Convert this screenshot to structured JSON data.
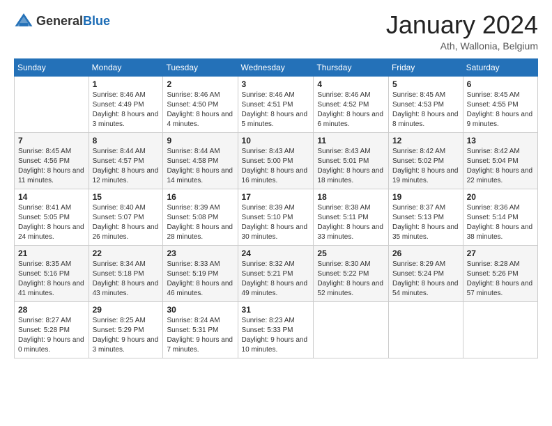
{
  "header": {
    "logo_general": "General",
    "logo_blue": "Blue",
    "month_title": "January 2024",
    "subtitle": "Ath, Wallonia, Belgium"
  },
  "weekdays": [
    "Sunday",
    "Monday",
    "Tuesday",
    "Wednesday",
    "Thursday",
    "Friday",
    "Saturday"
  ],
  "rows": [
    [
      {
        "day": "",
        "sunrise": "",
        "sunset": "",
        "daylight": ""
      },
      {
        "day": "1",
        "sunrise": "Sunrise: 8:46 AM",
        "sunset": "Sunset: 4:49 PM",
        "daylight": "Daylight: 8 hours and 3 minutes."
      },
      {
        "day": "2",
        "sunrise": "Sunrise: 8:46 AM",
        "sunset": "Sunset: 4:50 PM",
        "daylight": "Daylight: 8 hours and 4 minutes."
      },
      {
        "day": "3",
        "sunrise": "Sunrise: 8:46 AM",
        "sunset": "Sunset: 4:51 PM",
        "daylight": "Daylight: 8 hours and 5 minutes."
      },
      {
        "day": "4",
        "sunrise": "Sunrise: 8:46 AM",
        "sunset": "Sunset: 4:52 PM",
        "daylight": "Daylight: 8 hours and 6 minutes."
      },
      {
        "day": "5",
        "sunrise": "Sunrise: 8:45 AM",
        "sunset": "Sunset: 4:53 PM",
        "daylight": "Daylight: 8 hours and 8 minutes."
      },
      {
        "day": "6",
        "sunrise": "Sunrise: 8:45 AM",
        "sunset": "Sunset: 4:55 PM",
        "daylight": "Daylight: 8 hours and 9 minutes."
      }
    ],
    [
      {
        "day": "7",
        "sunrise": "Sunrise: 8:45 AM",
        "sunset": "Sunset: 4:56 PM",
        "daylight": "Daylight: 8 hours and 11 minutes."
      },
      {
        "day": "8",
        "sunrise": "Sunrise: 8:44 AM",
        "sunset": "Sunset: 4:57 PM",
        "daylight": "Daylight: 8 hours and 12 minutes."
      },
      {
        "day": "9",
        "sunrise": "Sunrise: 8:44 AM",
        "sunset": "Sunset: 4:58 PM",
        "daylight": "Daylight: 8 hours and 14 minutes."
      },
      {
        "day": "10",
        "sunrise": "Sunrise: 8:43 AM",
        "sunset": "Sunset: 5:00 PM",
        "daylight": "Daylight: 8 hours and 16 minutes."
      },
      {
        "day": "11",
        "sunrise": "Sunrise: 8:43 AM",
        "sunset": "Sunset: 5:01 PM",
        "daylight": "Daylight: 8 hours and 18 minutes."
      },
      {
        "day": "12",
        "sunrise": "Sunrise: 8:42 AM",
        "sunset": "Sunset: 5:02 PM",
        "daylight": "Daylight: 8 hours and 19 minutes."
      },
      {
        "day": "13",
        "sunrise": "Sunrise: 8:42 AM",
        "sunset": "Sunset: 5:04 PM",
        "daylight": "Daylight: 8 hours and 22 minutes."
      }
    ],
    [
      {
        "day": "14",
        "sunrise": "Sunrise: 8:41 AM",
        "sunset": "Sunset: 5:05 PM",
        "daylight": "Daylight: 8 hours and 24 minutes."
      },
      {
        "day": "15",
        "sunrise": "Sunrise: 8:40 AM",
        "sunset": "Sunset: 5:07 PM",
        "daylight": "Daylight: 8 hours and 26 minutes."
      },
      {
        "day": "16",
        "sunrise": "Sunrise: 8:39 AM",
        "sunset": "Sunset: 5:08 PM",
        "daylight": "Daylight: 8 hours and 28 minutes."
      },
      {
        "day": "17",
        "sunrise": "Sunrise: 8:39 AM",
        "sunset": "Sunset: 5:10 PM",
        "daylight": "Daylight: 8 hours and 30 minutes."
      },
      {
        "day": "18",
        "sunrise": "Sunrise: 8:38 AM",
        "sunset": "Sunset: 5:11 PM",
        "daylight": "Daylight: 8 hours and 33 minutes."
      },
      {
        "day": "19",
        "sunrise": "Sunrise: 8:37 AM",
        "sunset": "Sunset: 5:13 PM",
        "daylight": "Daylight: 8 hours and 35 minutes."
      },
      {
        "day": "20",
        "sunrise": "Sunrise: 8:36 AM",
        "sunset": "Sunset: 5:14 PM",
        "daylight": "Daylight: 8 hours and 38 minutes."
      }
    ],
    [
      {
        "day": "21",
        "sunrise": "Sunrise: 8:35 AM",
        "sunset": "Sunset: 5:16 PM",
        "daylight": "Daylight: 8 hours and 41 minutes."
      },
      {
        "day": "22",
        "sunrise": "Sunrise: 8:34 AM",
        "sunset": "Sunset: 5:18 PM",
        "daylight": "Daylight: 8 hours and 43 minutes."
      },
      {
        "day": "23",
        "sunrise": "Sunrise: 8:33 AM",
        "sunset": "Sunset: 5:19 PM",
        "daylight": "Daylight: 8 hours and 46 minutes."
      },
      {
        "day": "24",
        "sunrise": "Sunrise: 8:32 AM",
        "sunset": "Sunset: 5:21 PM",
        "daylight": "Daylight: 8 hours and 49 minutes."
      },
      {
        "day": "25",
        "sunrise": "Sunrise: 8:30 AM",
        "sunset": "Sunset: 5:22 PM",
        "daylight": "Daylight: 8 hours and 52 minutes."
      },
      {
        "day": "26",
        "sunrise": "Sunrise: 8:29 AM",
        "sunset": "Sunset: 5:24 PM",
        "daylight": "Daylight: 8 hours and 54 minutes."
      },
      {
        "day": "27",
        "sunrise": "Sunrise: 8:28 AM",
        "sunset": "Sunset: 5:26 PM",
        "daylight": "Daylight: 8 hours and 57 minutes."
      }
    ],
    [
      {
        "day": "28",
        "sunrise": "Sunrise: 8:27 AM",
        "sunset": "Sunset: 5:28 PM",
        "daylight": "Daylight: 9 hours and 0 minutes."
      },
      {
        "day": "29",
        "sunrise": "Sunrise: 8:25 AM",
        "sunset": "Sunset: 5:29 PM",
        "daylight": "Daylight: 9 hours and 3 minutes."
      },
      {
        "day": "30",
        "sunrise": "Sunrise: 8:24 AM",
        "sunset": "Sunset: 5:31 PM",
        "daylight": "Daylight: 9 hours and 7 minutes."
      },
      {
        "day": "31",
        "sunrise": "Sunrise: 8:23 AM",
        "sunset": "Sunset: 5:33 PM",
        "daylight": "Daylight: 9 hours and 10 minutes."
      },
      {
        "day": "",
        "sunrise": "",
        "sunset": "",
        "daylight": ""
      },
      {
        "day": "",
        "sunrise": "",
        "sunset": "",
        "daylight": ""
      },
      {
        "day": "",
        "sunrise": "",
        "sunset": "",
        "daylight": ""
      }
    ]
  ]
}
